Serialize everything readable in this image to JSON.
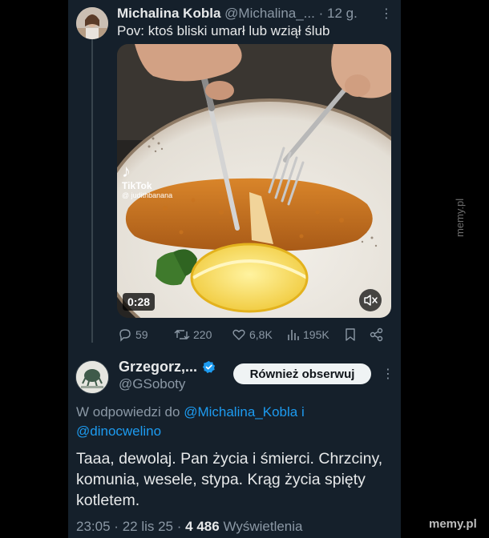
{
  "original_tweet": {
    "author_name": "Michalina Kobla",
    "handle_truncated": "@Michalina_...",
    "time_sep": "·",
    "age": "12 g.",
    "more": "⋮",
    "text": "Pov: ktoś bliski umarł lub wziął ślub",
    "media": {
      "duration": "0:28",
      "tiktok_brand": "TikTok",
      "tiktok_handle": "@ judithbanana"
    },
    "stats": {
      "replies": "59",
      "reposts": "220",
      "likes": "6,8K",
      "views": "195K"
    }
  },
  "reply_tweet": {
    "author_name": "Grzegorz,...",
    "handle": "@GSoboty",
    "follow_label": "Również obserwuj",
    "more": "⋮",
    "reply_prefix": "W odpowiedzi do",
    "reply_mention_1": "@Michalina_Kobla",
    "reply_and": "i",
    "reply_mention_2": "@dinocwelino",
    "text": "Taaa, dewolaj. Pan życia i śmierci. Chrzciny, komunia, wesele, stypa. Krąg życia spięty kotletem.",
    "time": "23:05",
    "date": "22 lis 25",
    "views_count": "4 486",
    "views_label": "Wyświetlenia"
  },
  "watermarks": {
    "side": "memy.pl",
    "bottom": "memy.pl"
  },
  "colors": {
    "background": "#15202b",
    "text": "#e7e9ea",
    "muted": "#8b98a5",
    "link": "#1d9bf0",
    "verified": "#1d9bf0"
  }
}
